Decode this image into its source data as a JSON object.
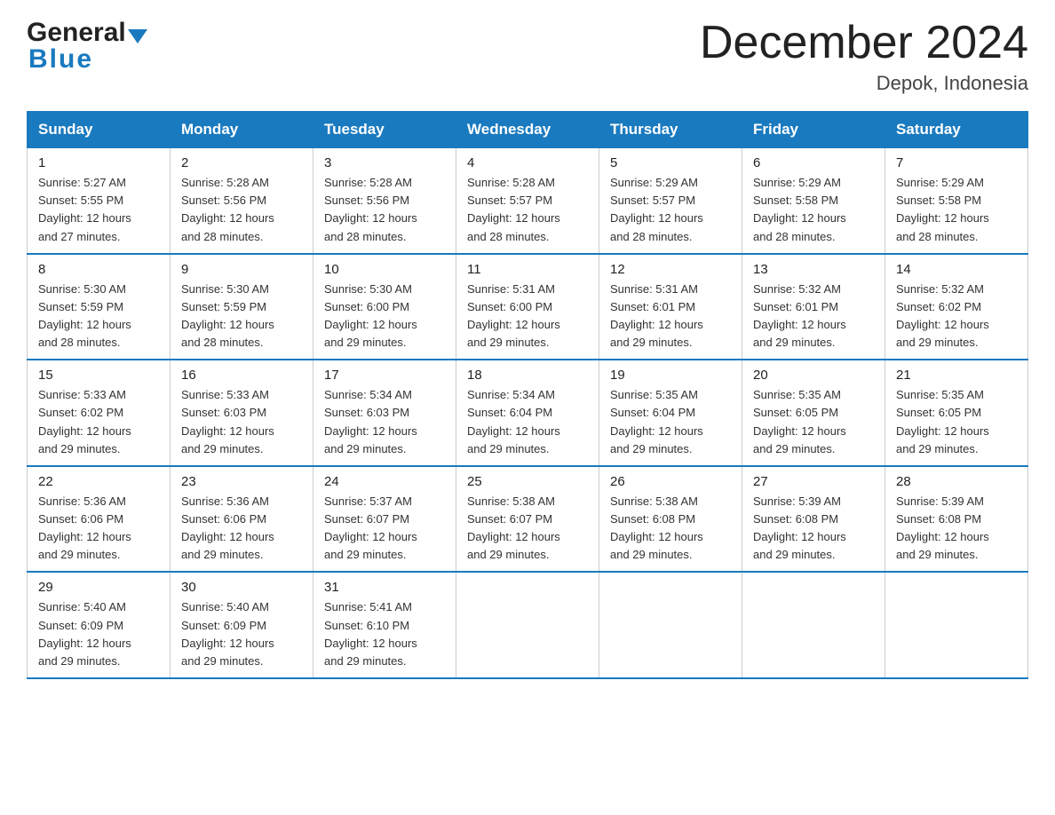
{
  "header": {
    "logo_general": "General",
    "logo_blue": "Blue",
    "title": "December 2024",
    "subtitle": "Depok, Indonesia"
  },
  "calendar": {
    "days_of_week": [
      "Sunday",
      "Monday",
      "Tuesday",
      "Wednesday",
      "Thursday",
      "Friday",
      "Saturday"
    ],
    "weeks": [
      [
        {
          "date": "1",
          "sunrise": "5:27 AM",
          "sunset": "5:55 PM",
          "daylight": "12 hours and 27 minutes."
        },
        {
          "date": "2",
          "sunrise": "5:28 AM",
          "sunset": "5:56 PM",
          "daylight": "12 hours and 28 minutes."
        },
        {
          "date": "3",
          "sunrise": "5:28 AM",
          "sunset": "5:56 PM",
          "daylight": "12 hours and 28 minutes."
        },
        {
          "date": "4",
          "sunrise": "5:28 AM",
          "sunset": "5:57 PM",
          "daylight": "12 hours and 28 minutes."
        },
        {
          "date": "5",
          "sunrise": "5:29 AM",
          "sunset": "5:57 PM",
          "daylight": "12 hours and 28 minutes."
        },
        {
          "date": "6",
          "sunrise": "5:29 AM",
          "sunset": "5:58 PM",
          "daylight": "12 hours and 28 minutes."
        },
        {
          "date": "7",
          "sunrise": "5:29 AM",
          "sunset": "5:58 PM",
          "daylight": "12 hours and 28 minutes."
        }
      ],
      [
        {
          "date": "8",
          "sunrise": "5:30 AM",
          "sunset": "5:59 PM",
          "daylight": "12 hours and 28 minutes."
        },
        {
          "date": "9",
          "sunrise": "5:30 AM",
          "sunset": "5:59 PM",
          "daylight": "12 hours and 28 minutes."
        },
        {
          "date": "10",
          "sunrise": "5:30 AM",
          "sunset": "6:00 PM",
          "daylight": "12 hours and 29 minutes."
        },
        {
          "date": "11",
          "sunrise": "5:31 AM",
          "sunset": "6:00 PM",
          "daylight": "12 hours and 29 minutes."
        },
        {
          "date": "12",
          "sunrise": "5:31 AM",
          "sunset": "6:01 PM",
          "daylight": "12 hours and 29 minutes."
        },
        {
          "date": "13",
          "sunrise": "5:32 AM",
          "sunset": "6:01 PM",
          "daylight": "12 hours and 29 minutes."
        },
        {
          "date": "14",
          "sunrise": "5:32 AM",
          "sunset": "6:02 PM",
          "daylight": "12 hours and 29 minutes."
        }
      ],
      [
        {
          "date": "15",
          "sunrise": "5:33 AM",
          "sunset": "6:02 PM",
          "daylight": "12 hours and 29 minutes."
        },
        {
          "date": "16",
          "sunrise": "5:33 AM",
          "sunset": "6:03 PM",
          "daylight": "12 hours and 29 minutes."
        },
        {
          "date": "17",
          "sunrise": "5:34 AM",
          "sunset": "6:03 PM",
          "daylight": "12 hours and 29 minutes."
        },
        {
          "date": "18",
          "sunrise": "5:34 AM",
          "sunset": "6:04 PM",
          "daylight": "12 hours and 29 minutes."
        },
        {
          "date": "19",
          "sunrise": "5:35 AM",
          "sunset": "6:04 PM",
          "daylight": "12 hours and 29 minutes."
        },
        {
          "date": "20",
          "sunrise": "5:35 AM",
          "sunset": "6:05 PM",
          "daylight": "12 hours and 29 minutes."
        },
        {
          "date": "21",
          "sunrise": "5:35 AM",
          "sunset": "6:05 PM",
          "daylight": "12 hours and 29 minutes."
        }
      ],
      [
        {
          "date": "22",
          "sunrise": "5:36 AM",
          "sunset": "6:06 PM",
          "daylight": "12 hours and 29 minutes."
        },
        {
          "date": "23",
          "sunrise": "5:36 AM",
          "sunset": "6:06 PM",
          "daylight": "12 hours and 29 minutes."
        },
        {
          "date": "24",
          "sunrise": "5:37 AM",
          "sunset": "6:07 PM",
          "daylight": "12 hours and 29 minutes."
        },
        {
          "date": "25",
          "sunrise": "5:38 AM",
          "sunset": "6:07 PM",
          "daylight": "12 hours and 29 minutes."
        },
        {
          "date": "26",
          "sunrise": "5:38 AM",
          "sunset": "6:08 PM",
          "daylight": "12 hours and 29 minutes."
        },
        {
          "date": "27",
          "sunrise": "5:39 AM",
          "sunset": "6:08 PM",
          "daylight": "12 hours and 29 minutes."
        },
        {
          "date": "28",
          "sunrise": "5:39 AM",
          "sunset": "6:08 PM",
          "daylight": "12 hours and 29 minutes."
        }
      ],
      [
        {
          "date": "29",
          "sunrise": "5:40 AM",
          "sunset": "6:09 PM",
          "daylight": "12 hours and 29 minutes."
        },
        {
          "date": "30",
          "sunrise": "5:40 AM",
          "sunset": "6:09 PM",
          "daylight": "12 hours and 29 minutes."
        },
        {
          "date": "31",
          "sunrise": "5:41 AM",
          "sunset": "6:10 PM",
          "daylight": "12 hours and 29 minutes."
        },
        null,
        null,
        null,
        null
      ]
    ],
    "label_sunrise": "Sunrise:",
    "label_sunset": "Sunset:",
    "label_daylight": "Daylight: 12 hours"
  }
}
